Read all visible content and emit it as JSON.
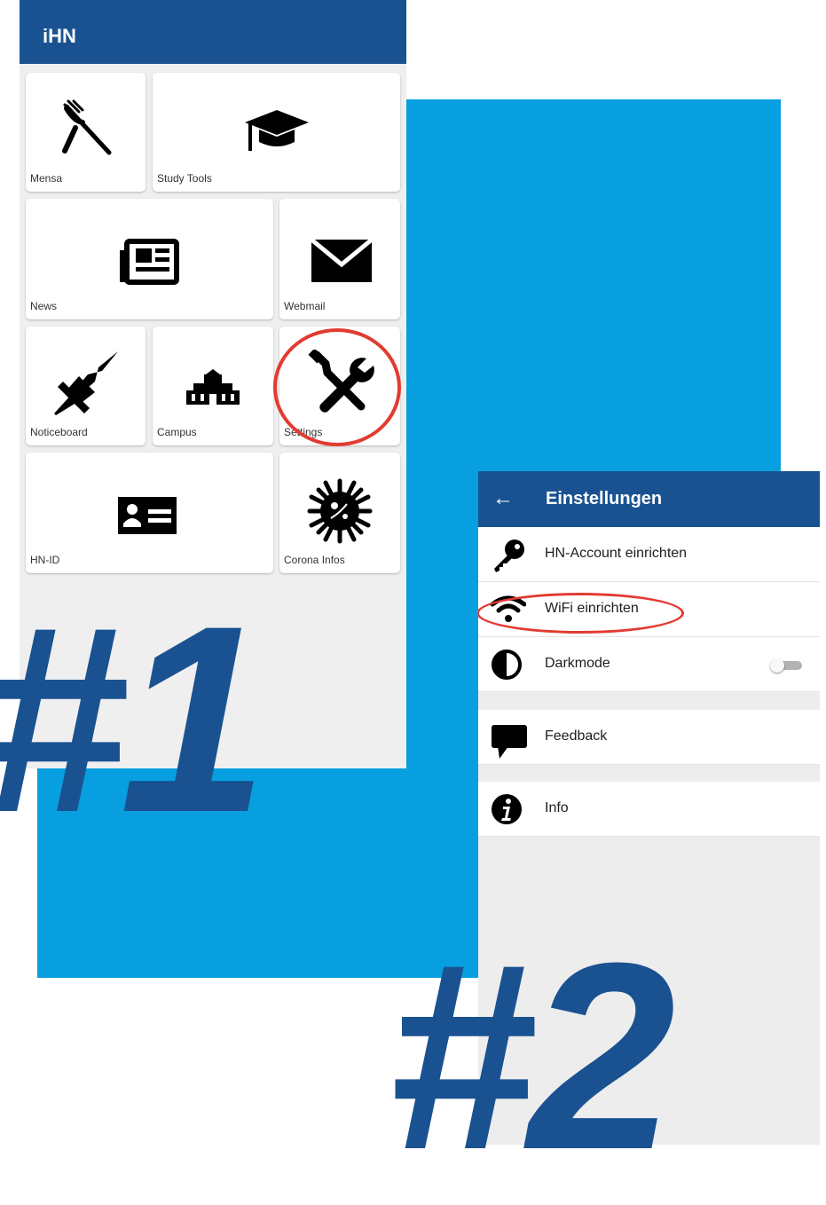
{
  "colors": {
    "app_bar": "#1a5291",
    "background_block": "#079fe0",
    "highlight_ring": "#e23b31",
    "big_number": "#1a5291"
  },
  "screen1": {
    "app_title": "iHN",
    "tiles": [
      {
        "label": "Mensa",
        "icon": "cutlery-icon"
      },
      {
        "label": "Study Tools",
        "icon": "graduation-cap-icon"
      },
      {
        "label": "News",
        "icon": "newspaper-icon"
      },
      {
        "label": "Webmail",
        "icon": "envelope-icon"
      },
      {
        "label": "Noticeboard",
        "icon": "pushpin-icon"
      },
      {
        "label": "Campus",
        "icon": "building-icon"
      },
      {
        "label": "Settings",
        "icon": "wrench-screwdriver-icon"
      },
      {
        "label": "HN-ID",
        "icon": "id-card-icon"
      },
      {
        "label": "Corona Infos",
        "icon": "virus-icon"
      }
    ]
  },
  "screen2": {
    "back_icon": "arrow-left-icon",
    "title": "Einstellungen",
    "items": [
      {
        "label": "HN-Account einrichten",
        "icon": "key-icon"
      },
      {
        "label": "WiFi einrichten",
        "icon": "wifi-icon"
      },
      {
        "label": "Darkmode",
        "icon": "contrast-icon",
        "toggle_on": false
      },
      {
        "label": "Feedback",
        "icon": "speech-bubble-icon"
      },
      {
        "label": "Info",
        "icon": "info-icon"
      }
    ]
  },
  "step_labels": {
    "first": "#1",
    "second": "#2"
  }
}
